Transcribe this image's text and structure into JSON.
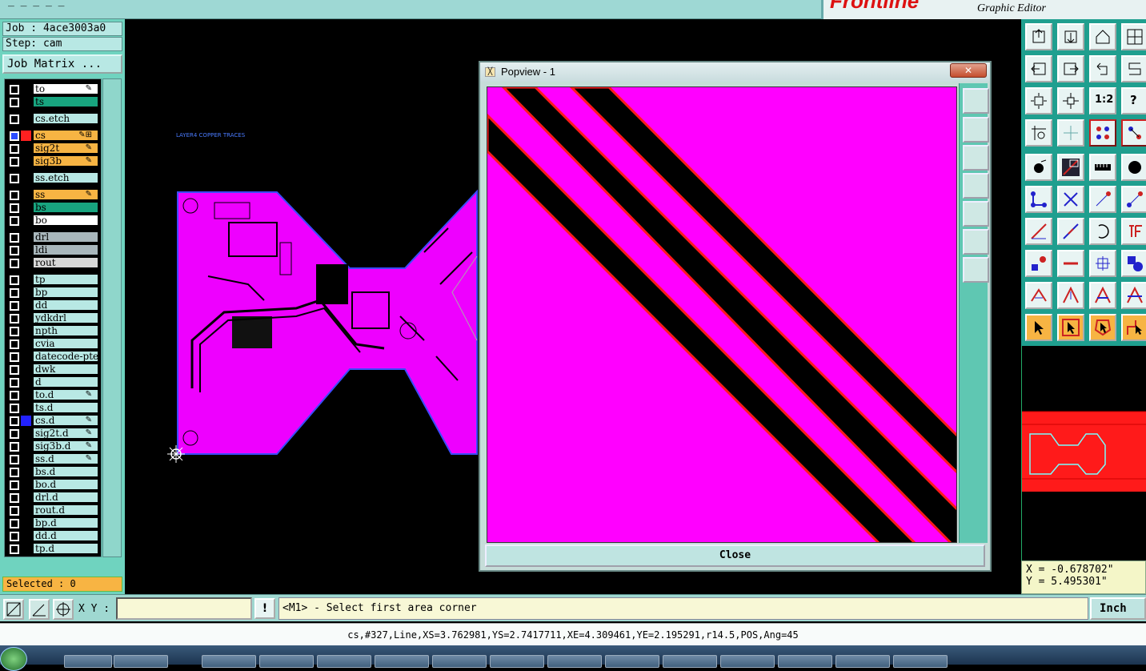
{
  "brand": {
    "logo": "Frontline",
    "subtitle": "Graphic Editor"
  },
  "job": {
    "job_line": "Job : 4ace3003a0",
    "step_line": "Step: cam",
    "matrix_button": "Job Matrix ..."
  },
  "layers": [
    {
      "name": "to",
      "bg": "#ffffff",
      "swatch": "#000000",
      "flag": "✎"
    },
    {
      "name": "ts",
      "bg": "#18a47f",
      "swatch": "#000000",
      "flag": ""
    },
    {
      "name": "cs.etch",
      "bg": "#b8e8e4",
      "swatch": "#000000",
      "flag": ""
    },
    {
      "name": "cs",
      "bg": "#f7b443",
      "swatch": "#ff2020",
      "flag": "✎⊞"
    },
    {
      "name": "sig2t",
      "bg": "#f7b443",
      "swatch": "#000000",
      "flag": "✎"
    },
    {
      "name": "sig3b",
      "bg": "#f7b443",
      "swatch": "#000000",
      "flag": "✎"
    },
    {
      "name": "ss.etch",
      "bg": "#b8e8e4",
      "swatch": "#000000",
      "flag": ""
    },
    {
      "name": "ss",
      "bg": "#f7b443",
      "swatch": "#000000",
      "flag": "✎"
    },
    {
      "name": "bs",
      "bg": "#18a47f",
      "swatch": "#000000",
      "flag": ""
    },
    {
      "name": "bo",
      "bg": "#ffffff",
      "swatch": "#000000",
      "flag": ""
    },
    {
      "name": "drl",
      "bg": "#a9b7bc",
      "swatch": "#000000",
      "flag": ""
    },
    {
      "name": "ldi",
      "bg": "#a9b7bc",
      "swatch": "#000000",
      "flag": ""
    },
    {
      "name": "rout",
      "bg": "#d8d8d8",
      "swatch": "#000000",
      "flag": ""
    },
    {
      "name": "tp",
      "bg": "#b8e8e4",
      "swatch": "#000000",
      "flag": ""
    },
    {
      "name": "bp",
      "bg": "#b8e8e4",
      "swatch": "#000000",
      "flag": ""
    },
    {
      "name": "dd",
      "bg": "#b8e8e4",
      "swatch": "#000000",
      "flag": ""
    },
    {
      "name": "ydkdrl",
      "bg": "#b8e8e4",
      "swatch": "#000000",
      "flag": ""
    },
    {
      "name": "npth",
      "bg": "#b8e8e4",
      "swatch": "#000000",
      "flag": ""
    },
    {
      "name": "cvia",
      "bg": "#b8e8e4",
      "swatch": "#000000",
      "flag": ""
    },
    {
      "name": "datecode-pte",
      "bg": "#b8e8e4",
      "swatch": "#000000",
      "flag": ""
    },
    {
      "name": "dwk",
      "bg": "#b8e8e4",
      "swatch": "#000000",
      "flag": ""
    },
    {
      "name": "d",
      "bg": "#b8e8e4",
      "swatch": "#000000",
      "flag": ""
    },
    {
      "name": "to.d",
      "bg": "#b8e8e4",
      "swatch": "#000000",
      "flag": "✎"
    },
    {
      "name": "ts.d",
      "bg": "#b8e8e4",
      "swatch": "#000000",
      "flag": ""
    },
    {
      "name": "cs.d",
      "bg": "#b8e8e4",
      "swatch": "#2222ff",
      "flag": "✎"
    },
    {
      "name": "sig2t.d",
      "bg": "#b8e8e4",
      "swatch": "#000000",
      "flag": "✎"
    },
    {
      "name": "sig3b.d",
      "bg": "#b8e8e4",
      "swatch": "#000000",
      "flag": "✎"
    },
    {
      "name": "ss.d",
      "bg": "#b8e8e4",
      "swatch": "#000000",
      "flag": "✎"
    },
    {
      "name": "bs.d",
      "bg": "#b8e8e4",
      "swatch": "#000000",
      "flag": ""
    },
    {
      "name": "bo.d",
      "bg": "#b8e8e4",
      "swatch": "#000000",
      "flag": ""
    },
    {
      "name": "drl.d",
      "bg": "#b8e8e4",
      "swatch": "#000000",
      "flag": ""
    },
    {
      "name": "rout.d",
      "bg": "#b8e8e4",
      "swatch": "#000000",
      "flag": ""
    },
    {
      "name": "bp.d",
      "bg": "#b8e8e4",
      "swatch": "#000000",
      "flag": ""
    },
    {
      "name": "dd.d",
      "bg": "#b8e8e4",
      "swatch": "#000000",
      "flag": ""
    },
    {
      "name": "tp.d",
      "bg": "#b8e8e4",
      "swatch": "#000000",
      "flag": ""
    }
  ],
  "selected_text": "Selected : 0",
  "canvas": {
    "layer_label": "LAYER4 COPPER TRACES",
    "board_color": "#ee00ff"
  },
  "popview": {
    "title": "Popview - 1",
    "close_x": "✕",
    "close_button": "Close",
    "view_color": "#ff00ff"
  },
  "toolbox": {
    "ratio_label": "1:2",
    "help_label": "?"
  },
  "coords": {
    "x": "X = -0.678702\"",
    "y": "Y = 5.495301\""
  },
  "command": {
    "xy_label": "X Y :",
    "xy_value": "",
    "prompt": "<M1> - Select first area corner",
    "unit": "Inch"
  },
  "status": "cs,#327,Line,XS=3.762981,YS=2.7417711,XE=4.309461,YE=2.195291,r14.5,POS,Ang=45"
}
